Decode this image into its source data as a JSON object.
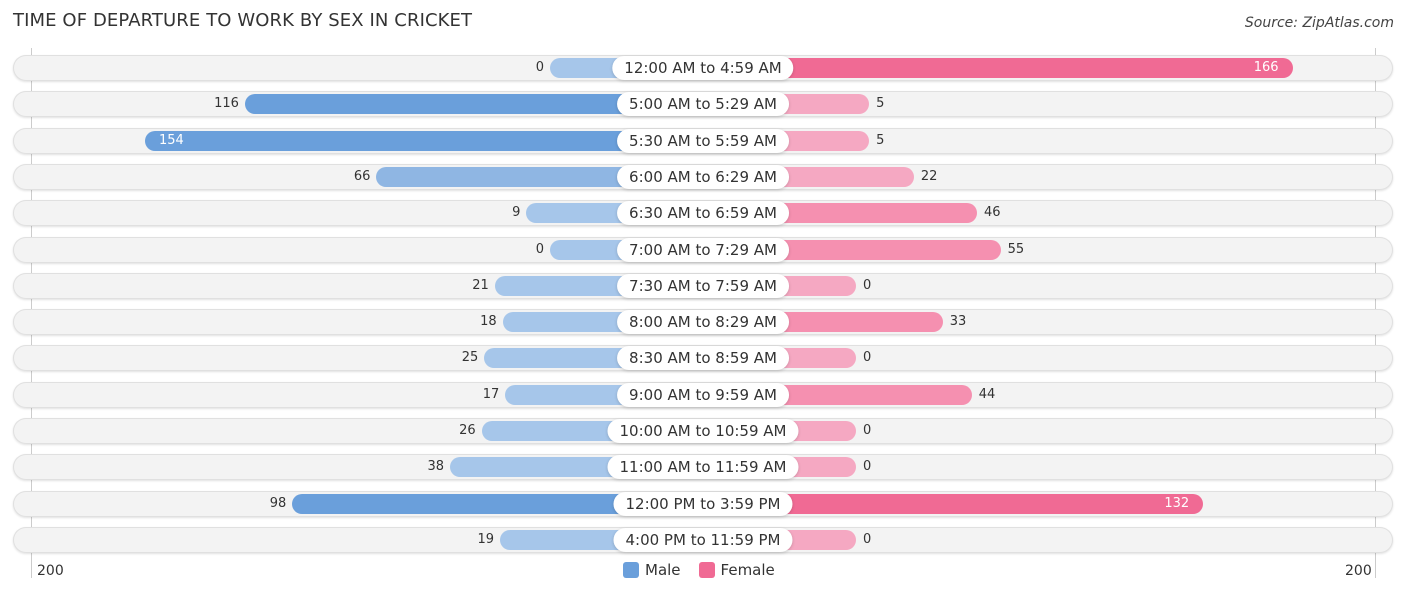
{
  "title": "TIME OF DEPARTURE TO WORK BY SEX IN CRICKET",
  "source": "Source: ZipAtlas.com",
  "colors": {
    "male_strong": "#6a9fdb",
    "male_light": "#a6c6ea",
    "female_strong": "#f06a94",
    "female_light": "#f5a8c2"
  },
  "axis": {
    "left_label": "200",
    "right_label": "200"
  },
  "legend": [
    {
      "label": "Male",
      "color": "#6a9fdb"
    },
    {
      "label": "Female",
      "color": "#f06a94"
    }
  ],
  "chart_data": {
    "type": "bar",
    "orientation": "horizontal-diverging",
    "title": "TIME OF DEPARTURE TO WORK BY SEX IN CRICKET",
    "xlim": [
      -200,
      200
    ],
    "legend_position": "bottom-center",
    "categories": [
      "12:00 AM to 4:59 AM",
      "5:00 AM to 5:29 AM",
      "5:30 AM to 5:59 AM",
      "6:00 AM to 6:29 AM",
      "6:30 AM to 6:59 AM",
      "7:00 AM to 7:29 AM",
      "7:30 AM to 7:59 AM",
      "8:00 AM to 8:29 AM",
      "8:30 AM to 8:59 AM",
      "9:00 AM to 9:59 AM",
      "10:00 AM to 10:59 AM",
      "11:00 AM to 11:59 AM",
      "12:00 PM to 3:59 PM",
      "4:00 PM to 11:59 PM"
    ],
    "series": [
      {
        "name": "Male",
        "values": [
          0,
          116,
          154,
          66,
          9,
          0,
          21,
          18,
          25,
          17,
          26,
          38,
          98,
          19
        ]
      },
      {
        "name": "Female",
        "values": [
          166,
          5,
          5,
          22,
          46,
          55,
          0,
          33,
          0,
          44,
          0,
          0,
          132,
          0
        ]
      }
    ]
  }
}
